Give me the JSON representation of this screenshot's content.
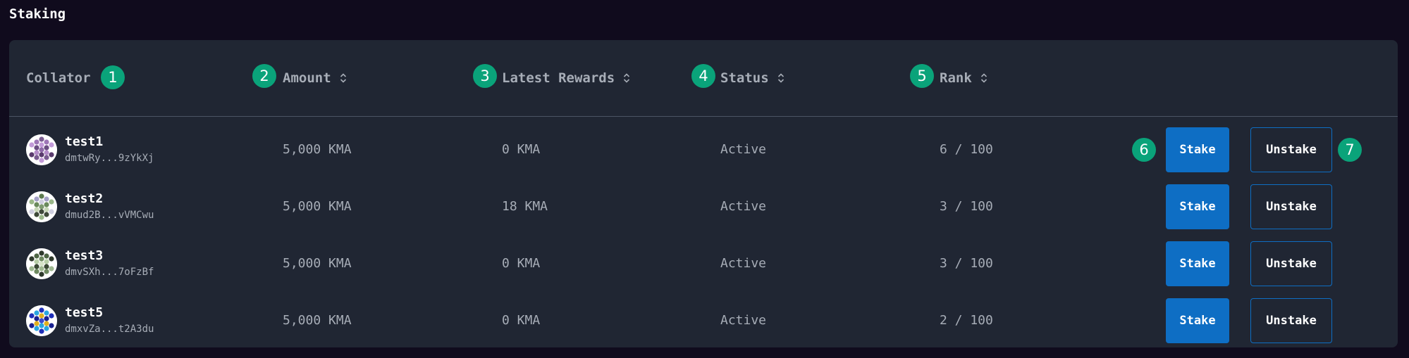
{
  "page": {
    "title": "Staking"
  },
  "table": {
    "headers": {
      "collator": "Collator",
      "amount": "Amount",
      "latest_rewards": "Latest Rewards",
      "status": "Status",
      "rank": "Rank"
    },
    "rows": [
      {
        "name": "test1",
        "address": "dmtwRy...9zYkXj",
        "amount": "5,000 KMA",
        "latest_rewards": "0 KMA",
        "status": "Active",
        "rank": "6 / 100",
        "stake_label": "Stake",
        "unstake_label": "Unstake"
      },
      {
        "name": "test2",
        "address": "dmud2B...vVMCwu",
        "amount": "5,000 KMA",
        "latest_rewards": "18 KMA",
        "status": "Active",
        "rank": "3 / 100",
        "stake_label": "Stake",
        "unstake_label": "Unstake"
      },
      {
        "name": "test3",
        "address": "dmvSXh...7oFzBf",
        "amount": "5,000 KMA",
        "latest_rewards": "0 KMA",
        "status": "Active",
        "rank": "3 / 100",
        "stake_label": "Stake",
        "unstake_label": "Unstake"
      },
      {
        "name": "test5",
        "address": "dmxvZa...t2A3du",
        "amount": "5,000 KMA",
        "latest_rewards": "0 KMA",
        "status": "Active",
        "rank": "2 / 100",
        "stake_label": "Stake",
        "unstake_label": "Unstake"
      }
    ]
  },
  "annotations": [
    "1",
    "2",
    "3",
    "4",
    "5",
    "6",
    "7"
  ],
  "colors": {
    "page_background": "#100b1d",
    "panel_background": "#202633",
    "button_blue": "#0e6ec4",
    "annotation_badge": "#0aa37a",
    "muted_text": "#a7adb7"
  },
  "icons": {
    "sort": "sort-icon",
    "avatar": "identicon-avatar"
  }
}
